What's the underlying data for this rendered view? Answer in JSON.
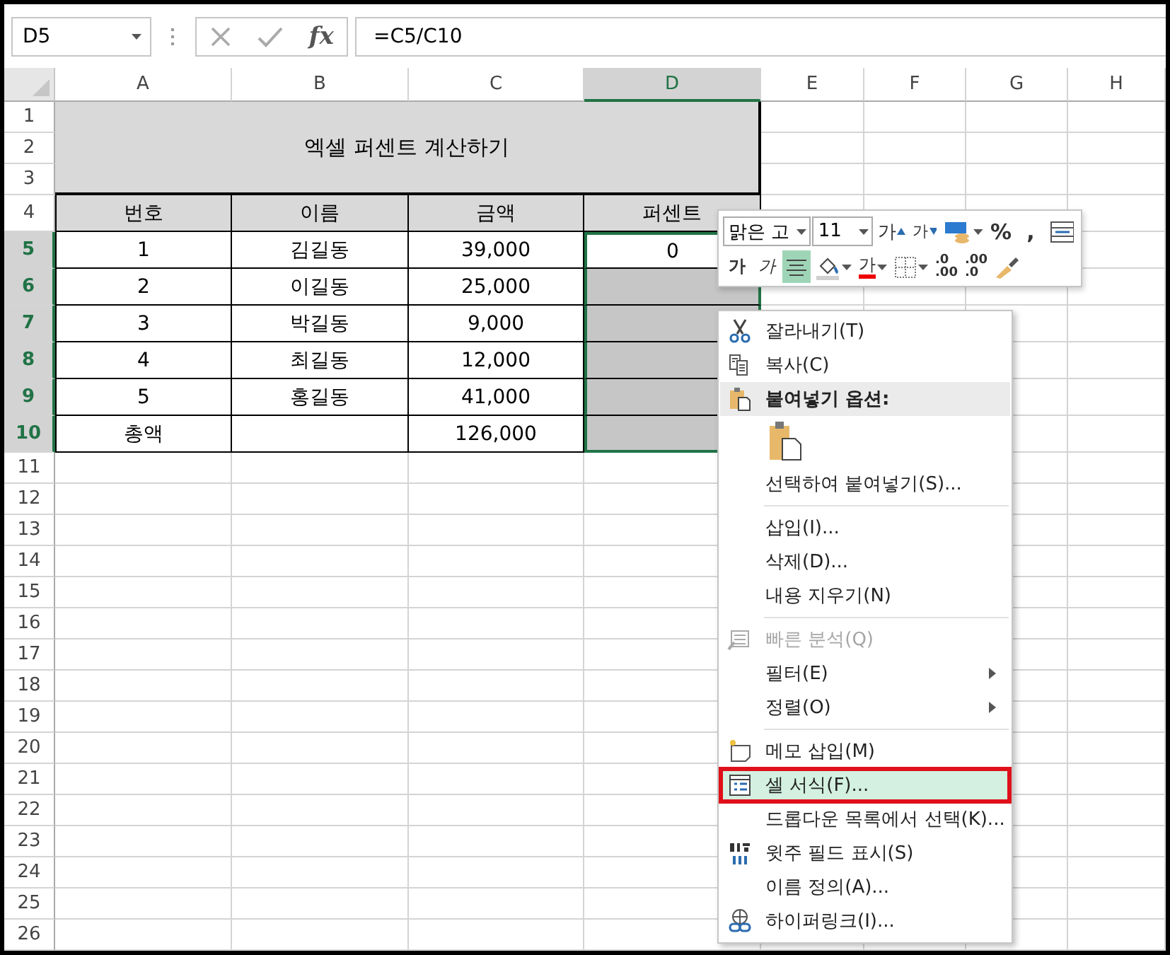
{
  "name_box": {
    "value": "D5"
  },
  "formula_bar": {
    "fx": "fx",
    "formula": "=C5/C10"
  },
  "columns": [
    {
      "label": "A",
      "selected": false
    },
    {
      "label": "B",
      "selected": false
    },
    {
      "label": "C",
      "selected": false
    },
    {
      "label": "D",
      "selected": true
    },
    {
      "label": "E",
      "selected": false
    },
    {
      "label": "F",
      "selected": false
    },
    {
      "label": "G",
      "selected": false
    },
    {
      "label": "H",
      "selected": false
    }
  ],
  "rows": [
    {
      "label": "1",
      "selected": false
    },
    {
      "label": "2",
      "selected": false
    },
    {
      "label": "3",
      "selected": false
    },
    {
      "label": "4",
      "selected": false
    },
    {
      "label": "5",
      "selected": true
    },
    {
      "label": "6",
      "selected": true
    },
    {
      "label": "7",
      "selected": true
    },
    {
      "label": "8",
      "selected": true
    },
    {
      "label": "9",
      "selected": true
    },
    {
      "label": "10",
      "selected": true
    },
    {
      "label": "11",
      "selected": false
    },
    {
      "label": "12",
      "selected": false
    },
    {
      "label": "13",
      "selected": false
    },
    {
      "label": "14",
      "selected": false
    },
    {
      "label": "15",
      "selected": false
    },
    {
      "label": "16",
      "selected": false
    },
    {
      "label": "17",
      "selected": false
    },
    {
      "label": "18",
      "selected": false
    },
    {
      "label": "19",
      "selected": false
    },
    {
      "label": "20",
      "selected": false
    },
    {
      "label": "21",
      "selected": false
    },
    {
      "label": "22",
      "selected": false
    },
    {
      "label": "23",
      "selected": false
    },
    {
      "label": "24",
      "selected": false
    },
    {
      "label": "25",
      "selected": false
    },
    {
      "label": "26",
      "selected": false
    }
  ],
  "table": {
    "title": "엑셀 퍼센트 계산하기",
    "columns": [
      "번호",
      "이름",
      "금액",
      "퍼센트"
    ],
    "rows": [
      {
        "cells": [
          "1",
          "김길동",
          "39,000",
          "0"
        ],
        "active": true
      },
      {
        "cells": [
          "2",
          "이길동",
          "25,000",
          null
        ],
        "active": false
      },
      {
        "cells": [
          "3",
          "박길동",
          "9,000",
          null
        ],
        "active": false
      },
      {
        "cells": [
          "4",
          "최길동",
          "12,000",
          null
        ],
        "active": false
      },
      {
        "cells": [
          "5",
          "홍길동",
          "41,000",
          null
        ],
        "active": false
      },
      {
        "cells": [
          "총액",
          null,
          "126,000",
          null
        ],
        "active": false
      }
    ]
  },
  "mini_toolbar": {
    "font": "맑은 고",
    "size": "11",
    "row_1": [
      {
        "kind": "grow",
        "label": "가"
      },
      {
        "kind": "shrink",
        "label": "가"
      },
      {
        "kind": "accounting",
        "dropdown": true
      },
      {
        "kind": "glyph",
        "label": "%"
      },
      {
        "kind": "glyph",
        "label": ","
      },
      {
        "kind": "merge"
      }
    ],
    "row_2": [
      {
        "kind": "bold",
        "label": "가"
      },
      {
        "kind": "italic",
        "label": "가"
      },
      {
        "kind": "center",
        "selected": true
      },
      {
        "kind": "fill",
        "dropdown": true
      },
      {
        "kind": "fontcolor",
        "label": "가",
        "dropdown": true
      },
      {
        "kind": "borders",
        "dropdown": true
      },
      {
        "kind": "decimal",
        "top": ".0",
        "bottom": ".00",
        "selected": false
      },
      {
        "kind": "decimal",
        "top": ".00",
        "bottom": ".0",
        "selected": false
      },
      {
        "kind": "painter"
      }
    ]
  },
  "context_menu": [
    {
      "kind": "cut",
      "label": "잘라내기(T)"
    },
    {
      "kind": "copy",
      "label": "복사(C)"
    },
    {
      "kind": "paste_header",
      "label": "붙여넣기 옵션:"
    },
    {
      "kind": "paste_options"
    },
    {
      "kind": "item",
      "label": "선택하여 붙여넣기(S)..."
    },
    {
      "kind": "separator"
    },
    {
      "kind": "item",
      "label": "삽입(I)..."
    },
    {
      "kind": "item",
      "label": "삭제(D)..."
    },
    {
      "kind": "item",
      "label": "내용 지우기(N)"
    },
    {
      "kind": "separator"
    },
    {
      "kind": "quick_analysis",
      "label": "빠른 분석(Q)",
      "disabled": true
    },
    {
      "kind": "item",
      "label": "필터(E)",
      "submenu": true
    },
    {
      "kind": "item",
      "label": "정렬(O)",
      "submenu": true
    },
    {
      "kind": "separator"
    },
    {
      "kind": "comment",
      "label": "메모 삽입(M)"
    },
    {
      "kind": "format_cells",
      "label": "셀 서식(F)...",
      "selected": true,
      "outlined": true
    },
    {
      "kind": "item",
      "label": "드롭다운 목록에서 선택(K)..."
    },
    {
      "kind": "phonetic",
      "label": "윗주 필드 표시(S)"
    },
    {
      "kind": "item",
      "label": "이름 정의(A)..."
    },
    {
      "kind": "hyperlink",
      "label": "하이퍼링크(I)..."
    }
  ]
}
